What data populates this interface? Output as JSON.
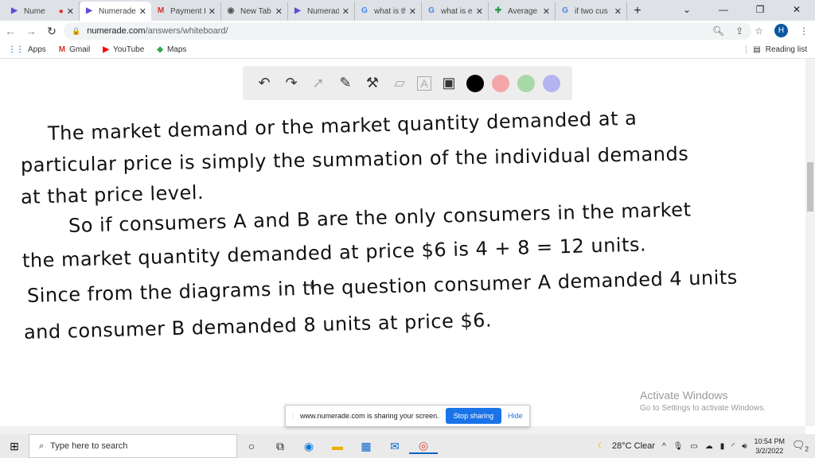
{
  "browser": {
    "tabs": [
      {
        "label": "Nume",
        "icon": "numerade-icon",
        "recording": true
      },
      {
        "label": "Numerade",
        "icon": "numerade-icon",
        "active": true
      },
      {
        "label": "Payment P",
        "icon": "gmail-icon"
      },
      {
        "label": "New Tab",
        "icon": "chrome-icon"
      },
      {
        "label": "Numerade",
        "icon": "numerade-icon"
      },
      {
        "label": "what is the",
        "icon": "google-icon"
      },
      {
        "label": "what is ex",
        "icon": "google-icon"
      },
      {
        "label": "Average R",
        "icon": "plus-cross-icon"
      },
      {
        "label": "if two cus",
        "icon": "google-icon"
      }
    ],
    "url_host": "numerade.com",
    "url_path": "/answers/whiteboard/",
    "profile_initial": "H",
    "bookmarks": [
      {
        "label": "Apps"
      },
      {
        "label": "Gmail"
      },
      {
        "label": "YouTube"
      },
      {
        "label": "Maps"
      }
    ],
    "reading_list": "Reading list"
  },
  "whiteboard": {
    "tools": [
      "undo-icon",
      "redo-icon",
      "pointer-icon",
      "pen-icon",
      "tools-icon",
      "eraser-icon",
      "text-icon",
      "image-icon"
    ],
    "colors": [
      "#000000",
      "#f4a6a6",
      "#a8d8a8",
      "#b4b4f0"
    ],
    "lines": [
      "The market demand or the market quantity demanded at a",
      "particular price is simply the summation of the individual demands",
      "at that price level.",
      "So if consumers A and B are the only consumers in the market",
      "the market quantity demanded at price $6 is  4 + 8 = 12 units.",
      "Since from the diagrams in the question consumer A demanded 4 units",
      "and consumer B demanded 8 units at price $6."
    ]
  },
  "activate": {
    "title": "Activate Windows",
    "subtitle": "Go to Settings to activate Windows."
  },
  "sharing": {
    "message": "www.numerade.com is sharing your screen.",
    "stop": "Stop sharing",
    "hide": "Hide"
  },
  "taskbar": {
    "search_placeholder": "Type here to search",
    "weather": "28°C  Clear",
    "time": "10:54 PM",
    "date": "3/2/2022",
    "notifications": "2"
  }
}
